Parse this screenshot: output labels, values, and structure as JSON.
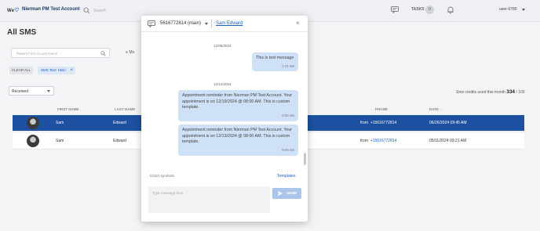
{
  "topbar": {
    "logo_text": "We",
    "brand": "Nierman PM Test Account",
    "search_placeholder": "Search",
    "tasks_label": "TASKS",
    "tasks_count": "0",
    "user": "user-9780"
  },
  "page": {
    "title": "All SMS",
    "filter_placeholder": "Patient First or Last Name",
    "more_label": "Mo",
    "clear_all": "CLEAR ALL",
    "active_filter": "SMS Text: Hello",
    "received_select": "Received",
    "credits_label": "Sms credits used this month",
    "credits_used": "334",
    "credits_total": "/ 100"
  },
  "table": {
    "headers": [
      "FIRST NAME",
      "LAST NAME",
      "PHONE",
      "DATE"
    ],
    "rows": [
      {
        "first": "Sam",
        "last": "Edward",
        "phone_prefix": "from",
        "phone": "+15616772814",
        "date": "06/26/2024 09:45 AM",
        "selected": true
      },
      {
        "first": "Sam",
        "last": "Edward",
        "phone_prefix": "from",
        "phone": "+15616772814",
        "date": "05/11/2024 09:21 AM",
        "selected": false
      }
    ]
  },
  "modal": {
    "number": "5616772814 (main)",
    "contact": "Sam Edward",
    "close": "×",
    "conversation": [
      {
        "date": "12/05/2024",
        "messages": [
          {
            "text": "This is test message",
            "time": "4:31 AM"
          }
        ]
      },
      {
        "date": "12/12/2024",
        "messages": [
          {
            "text": "Appointment reminder from Nierman PM Test Account. Your appointment is on 12/19/2024 @ 08:00 AM. This is custom template.",
            "time": "9:00 AM"
          },
          {
            "text": "Appointment reminder from Nierman PM Test Account. Your appointment is on 12/13/2024 @ 08:00 AM. This is custom template.",
            "time": "9:00 AM"
          }
        ]
      }
    ],
    "symbols": "0/320 symbols",
    "templates": "Templates",
    "input_placeholder": "Type message here",
    "send_label": "SEND"
  },
  "colors": {
    "accent": "#1a62c4",
    "selected_row": "#1d50a0",
    "bubble": "#cfe1f7"
  }
}
